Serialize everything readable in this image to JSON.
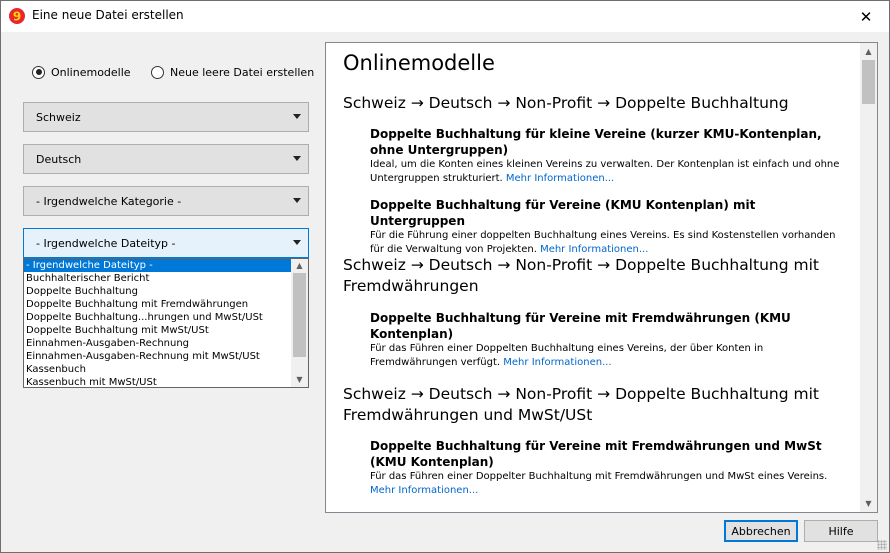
{
  "window": {
    "title": "Eine neue Datei erstellen",
    "close_glyph": "✕",
    "accent": "#0078d7"
  },
  "source": {
    "online_label": "Onlinemodelle",
    "empty_label": "Neue leere Datei erstellen",
    "selected": "online"
  },
  "filters": {
    "country": "Schweiz",
    "language": "Deutsch",
    "category": "- Irgendwelche Kategorie -",
    "filetype": "- Irgendwelche Dateityp -"
  },
  "filetype_options": [
    "- Irgendwelche Dateityp -",
    "Buchhalterischer Bericht",
    "Doppelte Buchhaltung",
    "Doppelte Buchhaltung mit Fremdwährungen",
    "Doppelte Buchhaltung...hrungen und MwSt/USt",
    "Doppelte Buchhaltung mit MwSt/USt",
    "Einnahmen-Ausgaben-Rechnung",
    "Einnahmen-Ausgaben-Rechnung mit MwSt/USt",
    "Kassenbuch",
    "Kassenbuch mit MwSt/USt"
  ],
  "content": {
    "heading": "Onlinemodelle",
    "sections": [
      {
        "path": "Schweiz → Deutsch → Non-Profit → Doppelte Buchhaltung",
        "entries": [
          {
            "title": "Doppelte Buchhaltung für kleine Vereine (kurzer KMU-Kontenplan, ohne Untergruppen)",
            "desc": "Ideal, um die Konten eines kleinen Vereins zu verwalten. Der Kontenplan ist einfach und ohne Untergruppen strukturiert.",
            "more": "Mehr Informationen..."
          },
          {
            "title": "Doppelte Buchhaltung für Vereine (KMU Kontenplan) mit Untergruppen",
            "desc": "Für die Führung einer doppelten Buchhaltung eines Vereins. Es sind Kostenstellen vorhanden für die Verwaltung von Projekten.",
            "more": "Mehr Informationen..."
          }
        ]
      },
      {
        "path": "Schweiz → Deutsch → Non-Profit → Doppelte Buchhaltung mit Fremdwährungen",
        "entries": [
          {
            "title": "Doppelte Buchhaltung für Vereine mit Fremdwährungen (KMU Kontenplan)",
            "desc": "Für das Führen einer Doppelten Buchhaltung eines Vereins, der über Konten in Fremdwährungen verfügt.",
            "more": "Mehr Informationen..."
          }
        ]
      },
      {
        "path": "Schweiz → Deutsch → Non-Profit → Doppelte Buchhaltung mit Fremdwährungen und MwSt/USt",
        "entries": [
          {
            "title": "Doppelte Buchhaltung für Vereine mit Fremdwährungen und MwSt (KMU Kontenplan)",
            "desc": "Für das Führen einer Doppelter Buchhaltung mit Fremdwährungen und MwSt eines Vereins.",
            "more": "Mehr Informationen..."
          }
        ]
      }
    ]
  },
  "buttons": {
    "cancel": "Abbrechen",
    "help": "Hilfe"
  }
}
